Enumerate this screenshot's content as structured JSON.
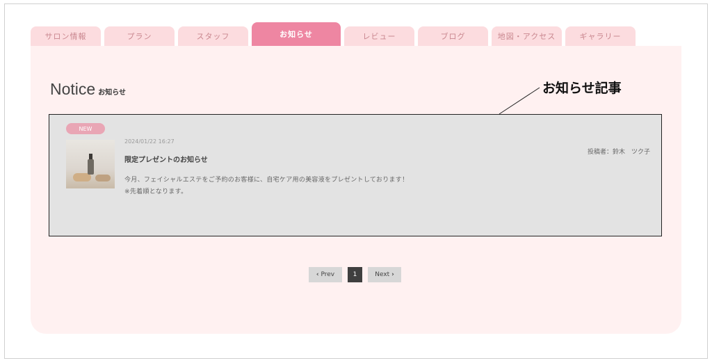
{
  "tabs": [
    {
      "label": "サロン情報"
    },
    {
      "label": "プラン"
    },
    {
      "label": "スタッフ"
    },
    {
      "label": "お知らせ"
    },
    {
      "label": "レビュー"
    },
    {
      "label": "ブログ"
    },
    {
      "label": "地図・アクセス"
    },
    {
      "label": "ギャラリー"
    }
  ],
  "active_tab": "お知らせ",
  "heading": {
    "en": "Notice",
    "jp": "お知らせ"
  },
  "callout": {
    "label": "お知らせ記事"
  },
  "notice": {
    "badge": "NEW",
    "date": "2024/01/22 16:27",
    "title": "限定プレゼントのお知らせ",
    "body_line1": "今月、フェイシャルエステをご予約のお客様に、自宅ケア用の美容液をプレゼントしております！",
    "body_line2": "※先着順となります。",
    "author": "投稿者：鈴木　ツク子"
  },
  "pagination": {
    "prev": "Prev",
    "current": "1",
    "next": "Next"
  },
  "colors": {
    "tab_bg": "#fcdcdf",
    "tab_active": "#ee86a2",
    "panel_bg": "#fff1f1",
    "badge": "#e9a6b5"
  }
}
